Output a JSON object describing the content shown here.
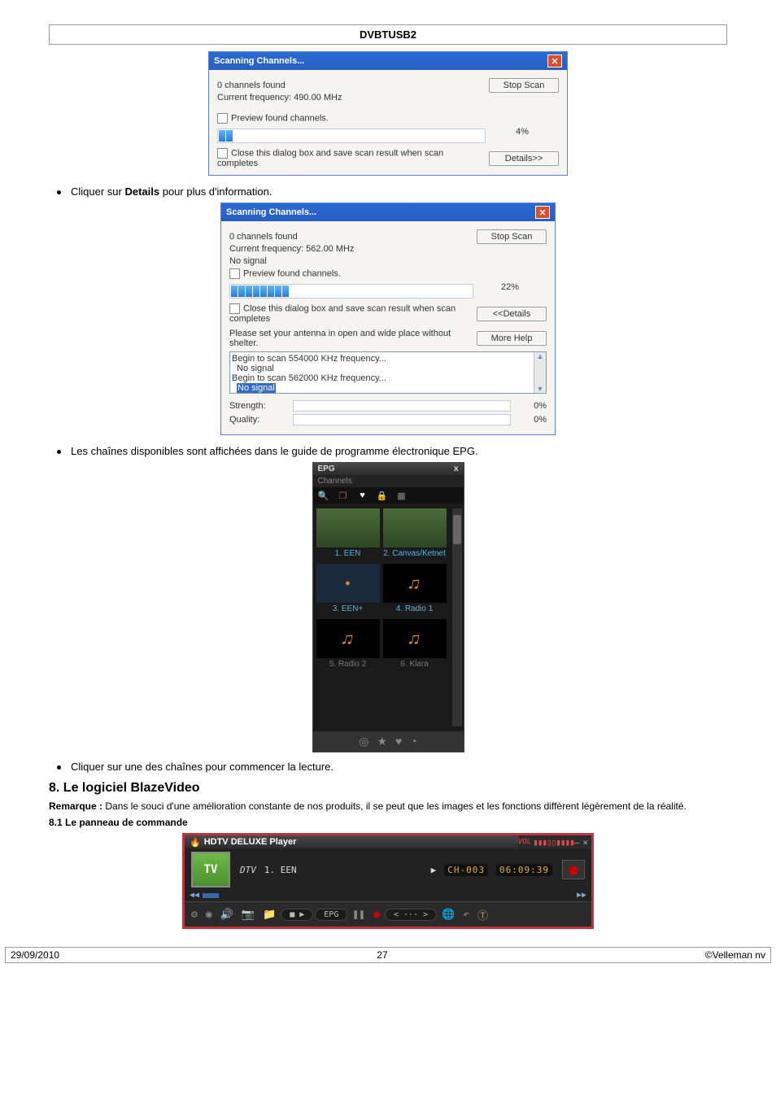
{
  "doc": {
    "header_title": "DVBTUSB2",
    "bullet_details": "Cliquer sur ",
    "bullet_details_bold": "Details",
    "bullet_details_after": " pour plus d'information.",
    "bullet_epg": "Les chaînes disponibles sont affichées dans le guide de programme électronique EPG.",
    "bullet_click_channel": "Cliquer sur une des chaînes pour commencer la lecture.",
    "heading_8": "8. Le logiciel BlazeVideo",
    "remark_label": "Remarque :",
    "remark_text": " Dans le souci d'une amélioration constante de nos produits, il se peut que les images et les fonctions diffèrent légèrement de la réalité.",
    "heading_81": "8.1 Le panneau de commande",
    "footer_date": "29/09/2010",
    "footer_page": "27",
    "footer_right": "©Velleman nv"
  },
  "dialog1": {
    "title": "Scanning Channels...",
    "channels_found": "0 channels found",
    "current_freq": "Current frequency: 490.00 MHz",
    "preview_label": "Preview found channels.",
    "close_label": "Close this dialog box and save scan result when scan completes",
    "percent": "4%",
    "btn_stop": "Stop Scan",
    "btn_details": "Details>>"
  },
  "dialog2": {
    "title": "Scanning Channels...",
    "channels_found": "0 channels found",
    "current_freq": "Current frequency: 562.00 MHz",
    "no_signal": "No signal",
    "preview_label": "Preview found channels.",
    "close_label": "Close this dialog box and save scan result when scan completes",
    "percent": "22%",
    "btn_stop": "Stop Scan",
    "btn_details": "<<Details",
    "antenna_hint": "Please set your antenna in open and wide place without shelter.",
    "btn_morehelp": "More Help",
    "log_l1": "Begin to scan 554000 KHz frequency...",
    "log_l2": "No signal",
    "log_l3": "Begin to scan 562000 KHz frequency...",
    "log_l4": "No signal",
    "strength_label": "Strength:",
    "quality_label": "Quality:",
    "strength_val": "0%",
    "quality_val": "0%"
  },
  "epg": {
    "title": "EPG",
    "close": "x",
    "subtitle": "Channels",
    "ch1": "1. EEN",
    "ch2": "2. Canvas/Ketnet",
    "ch3": "3. EEN+",
    "ch4": "4. Radio 1",
    "ch5": "5. Radio 2",
    "ch6": "6. Klara"
  },
  "player": {
    "title": "HDTV DELUXE Player",
    "tv": "TV",
    "dtv": "DTV",
    "ch_name": "1. EEN",
    "ch_num": "CH-003",
    "time": "06:09:39",
    "epg": "EPG",
    "vol_label": "VOL"
  }
}
